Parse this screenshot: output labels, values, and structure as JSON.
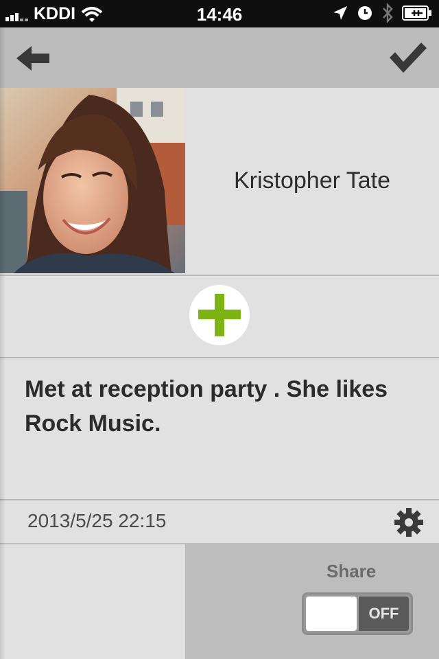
{
  "status_bar": {
    "carrier": "KDDI",
    "time": "14:46",
    "icons": [
      "signal-bars-icon",
      "wifi-icon",
      "location-arrow-icon",
      "clock-icon",
      "bluetooth-icon",
      "battery-charging-icon"
    ]
  },
  "nav": {
    "back_icon": "back-arrow-icon",
    "done_icon": "checkmark-icon"
  },
  "contact": {
    "name": "Kristopher Tate",
    "photo": "portrait-photo"
  },
  "add_button": {
    "icon": "plus-icon",
    "color": "#7db413"
  },
  "note": {
    "text": "Met at reception party . She likes Rock Music."
  },
  "meta": {
    "date": "2013/5/25 22:15",
    "settings_icon": "gear-icon"
  },
  "share": {
    "label": "Share",
    "toggle_state": "OFF"
  },
  "colors": {
    "accent": "#7db413",
    "background": "#e1e1e1",
    "navbar": "#bcbcbc",
    "statusbar": "#0f0f0f"
  }
}
